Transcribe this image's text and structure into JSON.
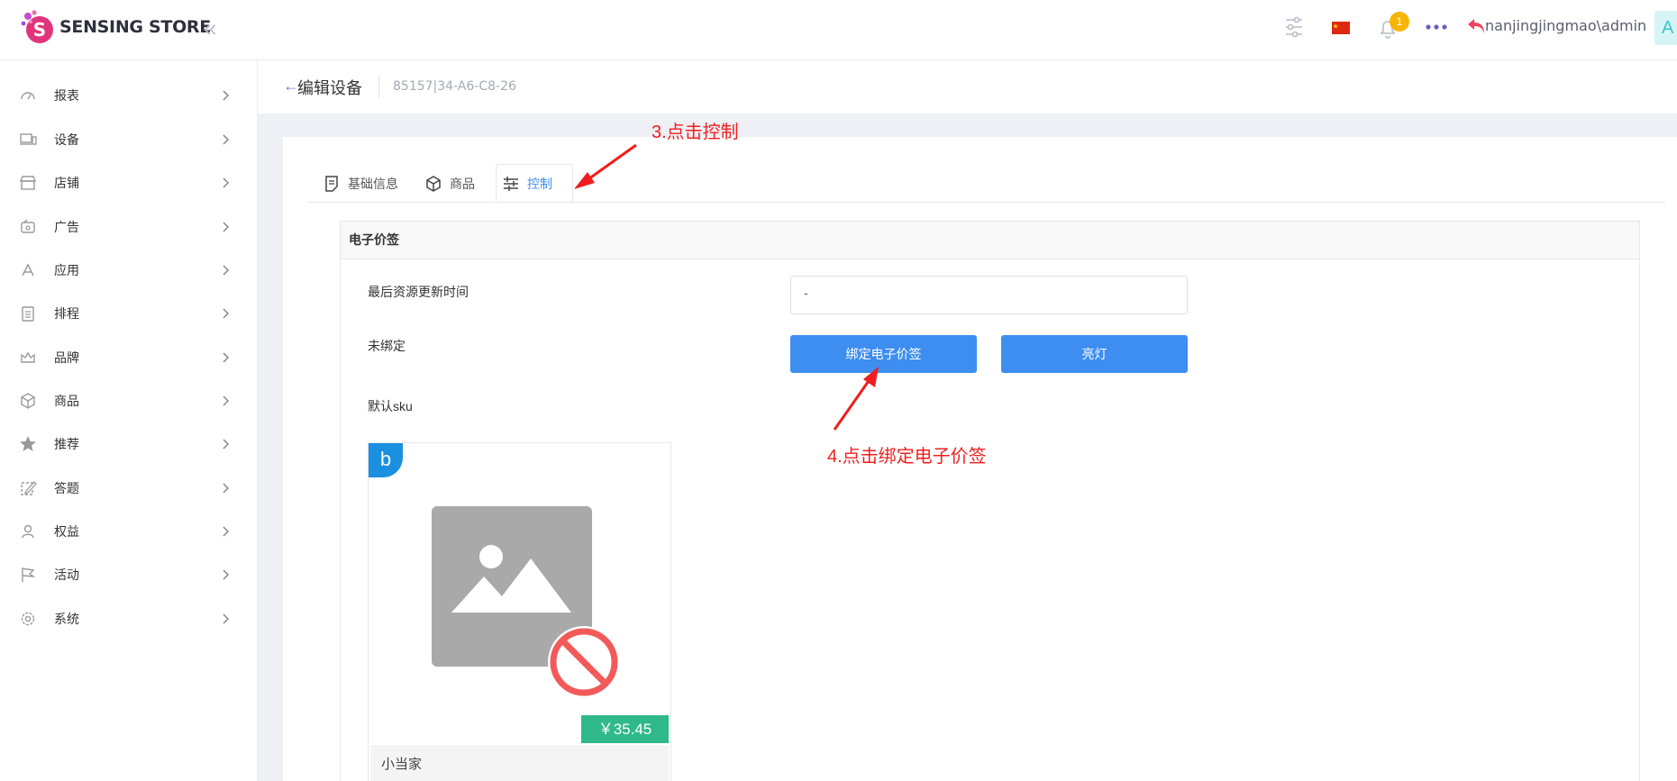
{
  "header": {
    "brand": "SENSING STORE",
    "notification_count": "1",
    "user": "nanjingjingmao\\admin",
    "avatar_letter": "A",
    "icons": [
      "settings-sliders-icon",
      "china-flag-icon",
      "bell-icon",
      "more-icon",
      "logout-icon"
    ]
  },
  "sidebar": {
    "items": [
      {
        "label": "报表",
        "icon": "dashboard-icon"
      },
      {
        "label": "设备",
        "icon": "devices-icon"
      },
      {
        "label": "店铺",
        "icon": "store-icon"
      },
      {
        "label": "广告",
        "icon": "ad-icon"
      },
      {
        "label": "应用",
        "icon": "apps-icon"
      },
      {
        "label": "排程",
        "icon": "schedule-icon"
      },
      {
        "label": "品牌",
        "icon": "crown-icon"
      },
      {
        "label": "商品",
        "icon": "box-icon"
      },
      {
        "label": "推荐",
        "icon": "star-icon"
      },
      {
        "label": "答题",
        "icon": "edit-icon"
      },
      {
        "label": "权益",
        "icon": "user-icon"
      },
      {
        "label": "活动",
        "icon": "flag-icon"
      },
      {
        "label": "系统",
        "icon": "gear-icon"
      }
    ]
  },
  "page": {
    "title": "编辑设备",
    "device_id": "85157|34-A6-C8-26"
  },
  "tabs": [
    {
      "label": "基础信息",
      "icon": "document-icon"
    },
    {
      "label": "商品",
      "icon": "cube-icon"
    },
    {
      "label": "控制",
      "icon": "sliders-icon",
      "active": true
    }
  ],
  "panel": {
    "title": "电子价签",
    "last_update_label": "最后资源更新时间",
    "last_update_value": "-",
    "bind_status": "未绑定",
    "bind_button": "绑定电子价签",
    "light_button": "亮灯",
    "default_sku_label": "默认sku"
  },
  "sku": {
    "badge": "b",
    "price": "￥35.45",
    "name": "小当家"
  },
  "annotations": {
    "step3": "3.点击控制",
    "step4": "4.点击绑定电子价签",
    "color": "#f01e1e"
  },
  "colors": {
    "primary": "#3d8ef0",
    "price_tag": "#2fb98b",
    "brand_pink": "#e0357d"
  }
}
